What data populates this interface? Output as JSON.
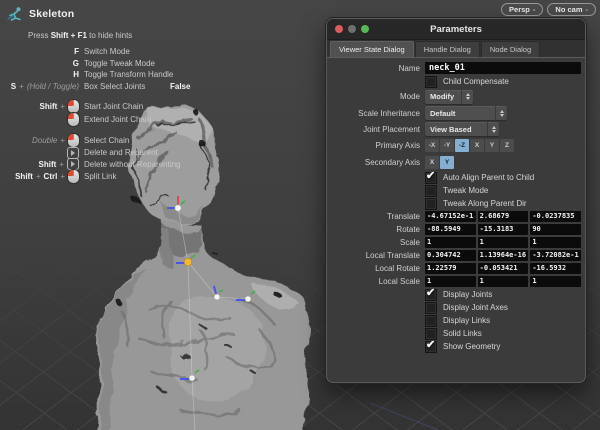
{
  "colors": {
    "accent": "#86aed2",
    "lmb": "#e0482f",
    "joint_selected": "#f2b632",
    "axis_x": "#e03c3c",
    "axis_y": "#3fae4a",
    "axis_z": "#4857e8",
    "value_field_bg": "#0b0b0b"
  },
  "icons": {
    "check": "✔"
  },
  "viewport": {
    "camera_menu": "Persp",
    "camera_assign_menu": "No cam",
    "menu_dash": "-",
    "model_description": "gray sculpted humanoid bust"
  },
  "hints": {
    "tool": "Skeleton",
    "press_prefix": "Press",
    "press_key": "Shift + F1",
    "press_suffix": "to hide hints",
    "keys": [
      {
        "key": "F",
        "label": "Switch Mode"
      },
      {
        "key": "G",
        "label": "Toggle Tweak Mode"
      },
      {
        "key": "H",
        "label": "Toggle Transform Handle"
      }
    ],
    "box_select": {
      "key": "S",
      "plus": "+",
      "mode": "(Hold / Toggle)",
      "label": "Box Select Joints",
      "value": "False"
    },
    "mouse": [
      {
        "mod": "Shift",
        "plus": "+",
        "icon": "lmb-icon",
        "label": "Start Joint Chain"
      },
      {
        "icon": "lmb-icon",
        "label": "Extend Joint Chain"
      },
      {
        "mod_italic": "Double",
        "plus": "+",
        "icon": "lmb-icon",
        "label": "Select Chain"
      },
      {
        "icon": "mmb-icon",
        "label": "Delete and Reparent"
      },
      {
        "mod": "Shift",
        "plus": "+",
        "icon": "mmb-icon",
        "label": "Delete without Reparenting"
      },
      {
        "mod": "Shift",
        "plus": "+",
        "mod2": "Ctrl",
        "plus2": "+",
        "icon": "lmb-icon",
        "label": "Split Link"
      }
    ]
  },
  "panel": {
    "title": "Parameters",
    "tabs": [
      "Viewer State Dialog",
      "Handle Dialog",
      "Node Dialog"
    ],
    "active_tab": "Viewer State Dialog",
    "fields": {
      "name_label": "Name",
      "name_value": "neck_01",
      "child_compensate_label": "Child Compensate",
      "child_compensate_checked": false,
      "mode_label": "Mode",
      "mode_value": "Modify",
      "scale_inheritance_label": "Scale Inheritance",
      "scale_inheritance_value": "Default",
      "joint_placement_label": "Joint Placement",
      "joint_placement_value": "View Based",
      "primary_axis_label": "Primary Axis",
      "primary_axis_options": [
        "-X",
        "-Y",
        "-Z",
        "X",
        "Y",
        "Z"
      ],
      "primary_axis_selected": "-Z",
      "secondary_axis_label": "Secondary Axis",
      "secondary_axis_options": [
        "X",
        "Y"
      ],
      "secondary_axis_selected": "Y",
      "checkboxes_top": [
        {
          "label": "Auto Align Parent to Child",
          "checked": true
        },
        {
          "label": "Tweak Mode",
          "checked": false
        },
        {
          "label": "Tweak Along Parent Dir",
          "checked": false
        }
      ],
      "vectors": [
        {
          "label": "Translate",
          "values": [
            "-4.67152e-1",
            "2.68679",
            "-0.0237835"
          ]
        },
        {
          "label": "Rotate",
          "values": [
            "-88.5949",
            "-15.3183",
            "90"
          ]
        },
        {
          "label": "Scale",
          "values": [
            "1",
            "1",
            "1"
          ]
        },
        {
          "label": "Local Translate",
          "values": [
            "0.304742",
            "1.13964e-16",
            "-3.72082e-1"
          ]
        },
        {
          "label": "Local Rotate",
          "values": [
            "1.22579",
            "-0.053421",
            "-16.5932"
          ]
        },
        {
          "label": "Local Scale",
          "values": [
            "1",
            "1",
            "1"
          ]
        }
      ],
      "checkboxes_bottom": [
        {
          "label": "Display Joints",
          "checked": true
        },
        {
          "label": "Display Joint Axes",
          "checked": false
        },
        {
          "label": "Display Links",
          "checked": false
        },
        {
          "label": "Solid Links",
          "checked": false
        },
        {
          "label": "Show Geometry",
          "checked": true
        }
      ]
    }
  }
}
